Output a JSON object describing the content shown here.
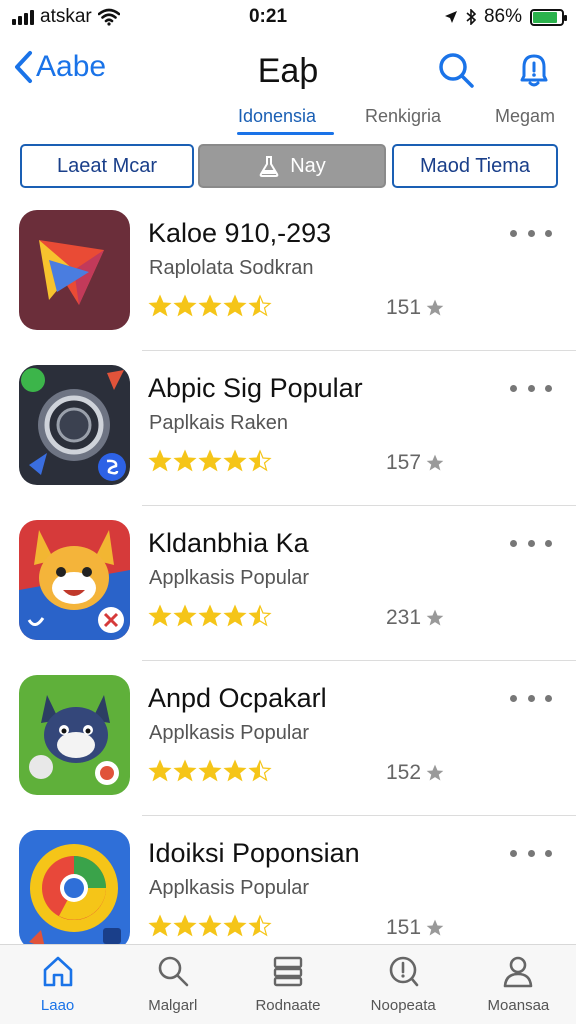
{
  "status_bar": {
    "carrier": "atskar",
    "time": "0:21",
    "battery_text": "86%",
    "battery_level": 0.86
  },
  "header": {
    "back_label": "Aabe",
    "title": "Eaþ",
    "search_icon": "search-icon",
    "notification_icon": "bell-alert-icon"
  },
  "segments": {
    "items": [
      {
        "label": "Idonensia",
        "active": true
      },
      {
        "label": "Renkigria",
        "active": false
      },
      {
        "label": "Megam",
        "active": false
      }
    ]
  },
  "filters": {
    "items": [
      {
        "label": "Laeat Mcar"
      },
      {
        "label": "Nay",
        "selected": true,
        "icon": "flask-icon"
      },
      {
        "label": "Maod Tiema"
      }
    ]
  },
  "apps": [
    {
      "name": "Kaloe 910,-293",
      "subtitle": "Raplolata Sodkran",
      "rating": 4.5,
      "count": "151"
    },
    {
      "name": "Abpic Sig Popular",
      "subtitle": "Paplkais Raken",
      "rating": 4.5,
      "count": "157"
    },
    {
      "name": "Kldanbhia Ka",
      "subtitle": "Applkasis Popular",
      "rating": 4.5,
      "count": "231"
    },
    {
      "name": "Anpd Ocpakarl",
      "subtitle": "Applkasis Popular",
      "rating": 4.5,
      "count": "152"
    },
    {
      "name": "Idoiksi Poponsian",
      "subtitle": "Applkasis Popular",
      "rating": 4.5,
      "count": "151"
    }
  ],
  "tab_bar": {
    "items": [
      {
        "label": "Laao",
        "icon": "home-icon",
        "active": true
      },
      {
        "label": "Malgarl",
        "icon": "search-icon",
        "active": false
      },
      {
        "label": "Rodnaate",
        "icon": "stack-icon",
        "active": false
      },
      {
        "label": "Noopeata",
        "icon": "updates-icon",
        "active": false
      },
      {
        "label": "Moansaa",
        "icon": "person-icon",
        "active": false
      }
    ]
  },
  "colors": {
    "accent": "#1a73e8",
    "star": "#f5c518",
    "battery": "#2bb24c"
  }
}
